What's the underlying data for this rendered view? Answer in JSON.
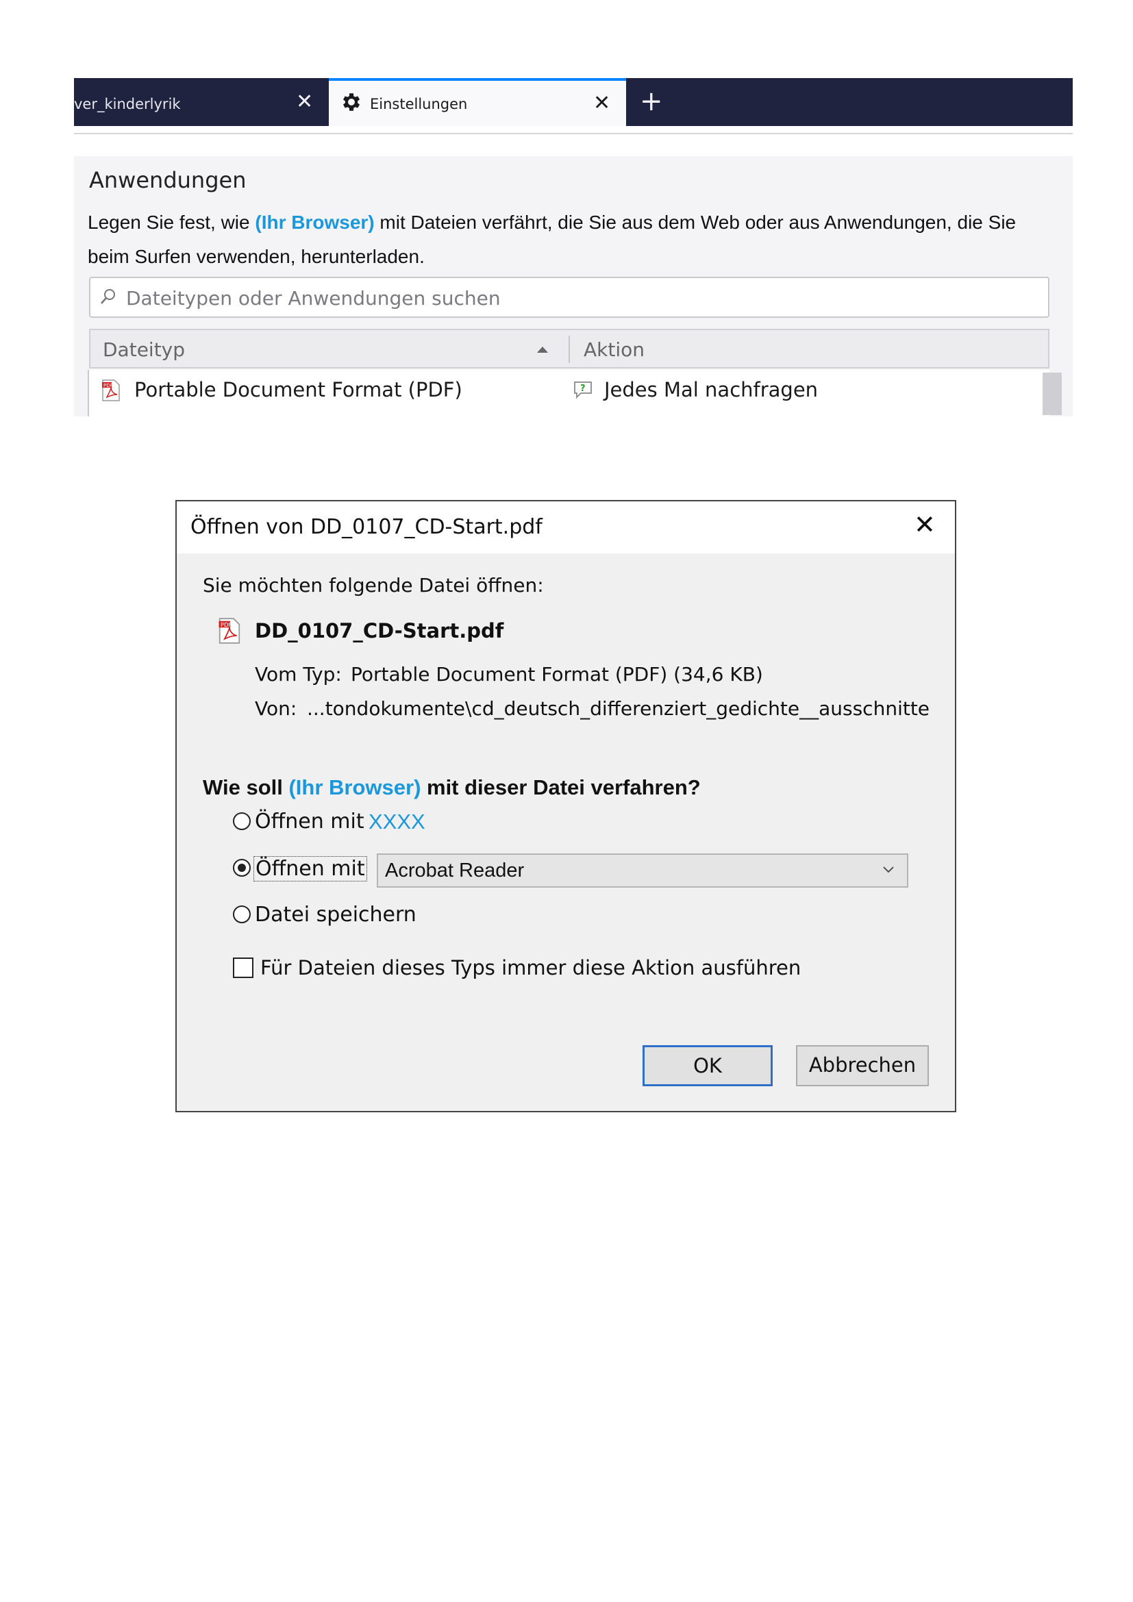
{
  "browser": {
    "tabs": [
      {
        "label": "ver_kinderlyrik",
        "active": false
      },
      {
        "label": "Einstellungen",
        "active": true
      }
    ],
    "accent_color": "#0a84ff"
  },
  "settings": {
    "title": "Anwendungen",
    "desc_before": "Legen Sie fest, wie ",
    "desc_highlight": "(Ihr Browser)",
    "desc_after": " mit Dateien verfährt, die Sie aus dem Web oder aus Anwendungen, die Sie beim Surfen verwenden, herunterladen.",
    "search_placeholder": "Dateitypen oder Anwendungen suchen",
    "table": {
      "col_type": "Dateityp",
      "col_action": "Aktion",
      "rows": [
        {
          "type": "Portable Document Format (PDF)",
          "action": "Jedes Mal nachfragen"
        }
      ]
    }
  },
  "dialog": {
    "title": "Öffnen von DD_0107_CD-Start.pdf",
    "intro": "Sie möchten folgende Datei öffnen:",
    "filename": "DD_0107_CD-Start.pdf",
    "type_label": "Vom Typ:",
    "type_value": "Portable Document Format (PDF) (34,6 KB)",
    "from_label": "Von:",
    "from_value": "...tondokumente\\cd_deutsch_differenziert_gedichte__ausschnitte",
    "question_before": "Wie soll ",
    "question_highlight": "(Ihr Browser)",
    "question_after": " mit dieser Datei verfahren?",
    "options": [
      {
        "label": "Öffnen mit",
        "app": "XXXX",
        "checked": false
      },
      {
        "label": "Öffnen mit",
        "checked": true
      },
      {
        "label": "Datei speichern",
        "checked": false
      }
    ],
    "open_with_value": "Acrobat Reader",
    "always_label": "Für Dateien dieses Typs immer diese Aktion ausführen",
    "always_checked": false,
    "ok_label": "OK",
    "cancel_label": "Abbrechen",
    "highlight_color": "#1b97db"
  }
}
